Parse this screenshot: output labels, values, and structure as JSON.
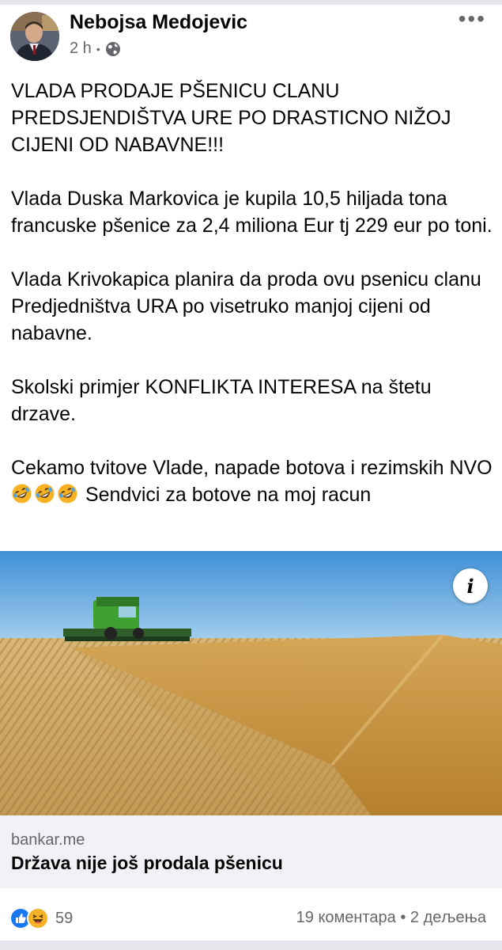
{
  "post": {
    "author": "Nebojsa Medojevic",
    "time": "2 h",
    "separator": "•",
    "privacy_icon": "globe-icon",
    "more_icon": "more-options-icon",
    "more_glyph": "•••",
    "paragraphs": [
      "VLADA PRODAJE PŠENICU CLANU PREDSJENDIŠTVA  URE PO DRASTICNO NIŽOJ CIJENI OD NABAVNE!!!",
      "Vlada Duska Markovica  je kupila 10,5 hiljada tona francuske pšenice  za 2,4 miliona Eur tj 229 eur po toni.",
      "Vlada Krivokapica planira da proda ovu psenicu clanu Predjedništva URA po visetruko manjoj cijeni od nabavne.",
      "Skolski primjer KONFLIKTA INTERESA na štetu drzave."
    ],
    "last_paragraph_start": "Cekamo tvitove Vlade, napade botova i rezimskih NVO",
    "last_paragraph_emoji": [
      "rolling-on-floor-laughing-emoji",
      "rolling-on-floor-laughing-emoji",
      "rolling-on-floor-laughing-emoji"
    ],
    "last_paragraph_end": " Sendvici za botove na moj racun"
  },
  "link": {
    "info_icon": "info-icon",
    "info_glyph": "i",
    "domain": "bankar.me",
    "title": "Država nije još prodala pšenicu"
  },
  "footer": {
    "reaction_icons": [
      "like-icon",
      "haha-icon"
    ],
    "reaction_count": "59",
    "comments": "19 коментара",
    "separator": "•",
    "shares": "2 дељења"
  },
  "colors": {
    "text": "#050505",
    "secondary": "#65676b",
    "preview_bg": "#f0f2f5",
    "divider": "#e4e6eb",
    "like_blue": "#1877f2",
    "haha_yellow": "#f7b125"
  }
}
